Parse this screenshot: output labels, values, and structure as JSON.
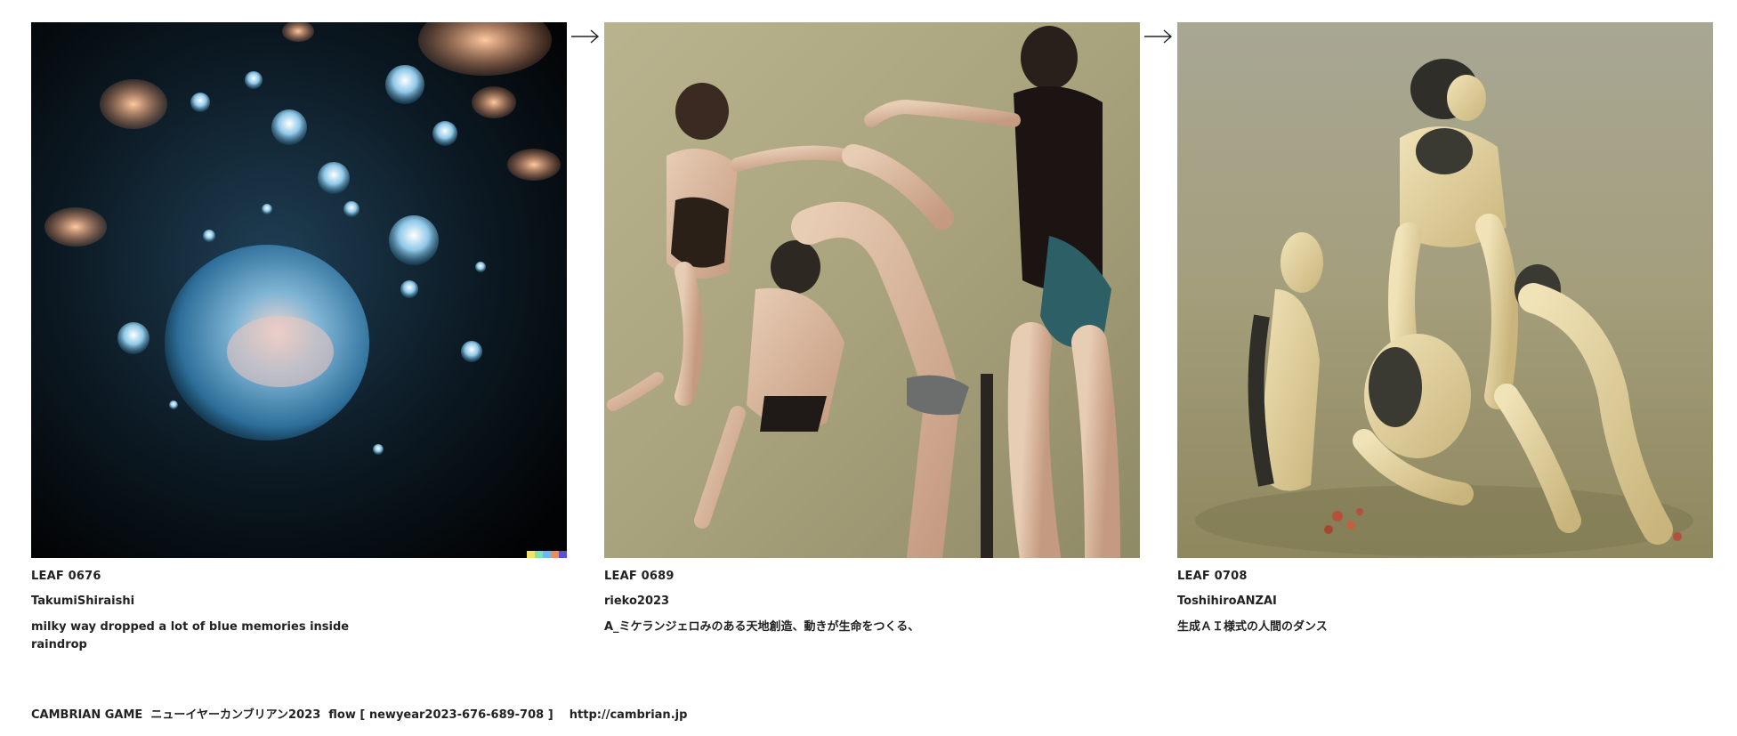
{
  "cards": [
    {
      "leaf": "LEAF 0676",
      "author": "TakumiShiraishi",
      "title": "milky way dropped a lot of blue memories inside raindrop",
      "image_subject": "water-droplets-artwork"
    },
    {
      "leaf": "LEAF 0689",
      "author": "rieko2023",
      "title": "A_ミケランジェロみのある天地創造、動きが生命をつくる、",
      "image_subject": "dancers-artwork"
    },
    {
      "leaf": "LEAF 0708",
      "author": "ToshihiroANZAI",
      "title": "生成ＡＩ様式の人間のダンス",
      "image_subject": "surreal-figures-artwork"
    }
  ],
  "footer": {
    "series": "CAMBRIAN GAME  ニューイヤーカンブリアン2023  flow [ newyear2023-676-689-708 ]",
    "url": "http://cambrian.jp"
  },
  "colors": {
    "text": "#222222",
    "background": "#ffffff"
  }
}
